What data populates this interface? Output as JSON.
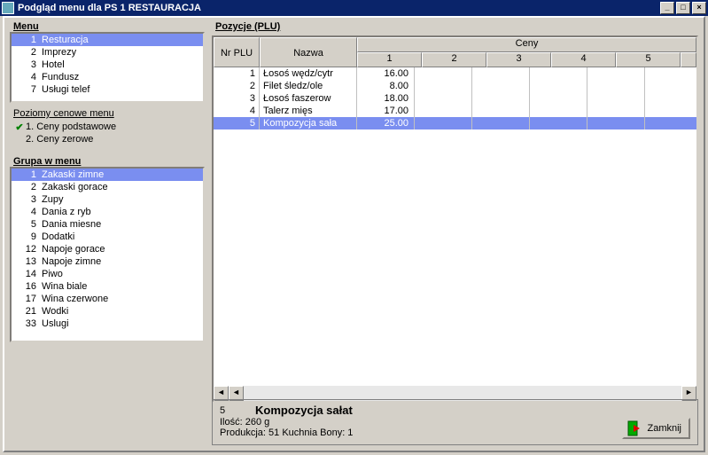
{
  "window": {
    "title": "Podgląd menu dla PS 1 RESTAURACJA"
  },
  "labels": {
    "menu": "Menu",
    "pozycje": "Pozycje (PLU)",
    "grupa": "Grupa w menu",
    "poziomy": "Poziomy cenowe menu",
    "nrplu": "Nr PLU",
    "nazwa": "Nazwa",
    "ceny": "Ceny",
    "zamknij": "Zamknij"
  },
  "priceCols": [
    "1",
    "2",
    "3",
    "4",
    "5"
  ],
  "menuItems": [
    {
      "id": "1",
      "name": "Resturacja",
      "selected": true
    },
    {
      "id": "2",
      "name": "Imprezy"
    },
    {
      "id": "3",
      "name": "Hotel"
    },
    {
      "id": "4",
      "name": "Fundusz"
    },
    {
      "id": "7",
      "name": "Usługi telef"
    }
  ],
  "priceLevels": [
    {
      "num": "1.",
      "label": "Ceny podstawowe",
      "checked": true
    },
    {
      "num": "2.",
      "label": "Ceny zerowe",
      "checked": false
    }
  ],
  "groups": [
    {
      "id": "1",
      "name": "Zakaski zimne",
      "selected": true
    },
    {
      "id": "2",
      "name": "Zakaski gorace"
    },
    {
      "id": "3",
      "name": "Zupy"
    },
    {
      "id": "4",
      "name": "Dania z ryb"
    },
    {
      "id": "5",
      "name": "Dania miesne"
    },
    {
      "id": "9",
      "name": "Dodatki"
    },
    {
      "id": "12",
      "name": "Napoje gorace"
    },
    {
      "id": "13",
      "name": "Napoje zimne"
    },
    {
      "id": "14",
      "name": "Piwo"
    },
    {
      "id": "16",
      "name": "Wina biale"
    },
    {
      "id": "17",
      "name": "Wina czerwone"
    },
    {
      "id": "21",
      "name": "Wodki"
    },
    {
      "id": "33",
      "name": "Uslugi"
    }
  ],
  "plu": [
    {
      "nr": "1",
      "name": "Łosoś wędz/cytr",
      "p1": "16.00"
    },
    {
      "nr": "2",
      "name": "Filet śledz/ole",
      "p1": "8.00"
    },
    {
      "nr": "3",
      "name": "Łosoś faszerow",
      "p1": "18.00"
    },
    {
      "nr": "4",
      "name": "Talerz mięs",
      "p1": "17.00"
    },
    {
      "nr": "5",
      "name": "Kompozycja sała",
      "p1": "25.00",
      "selected": true
    }
  ],
  "detail": {
    "num": "5",
    "name": "Kompozycja sałat",
    "ilosc": "Ilość: 260 g",
    "prod": "Produkcja:  51 Kuchnia   Bony: 1"
  }
}
